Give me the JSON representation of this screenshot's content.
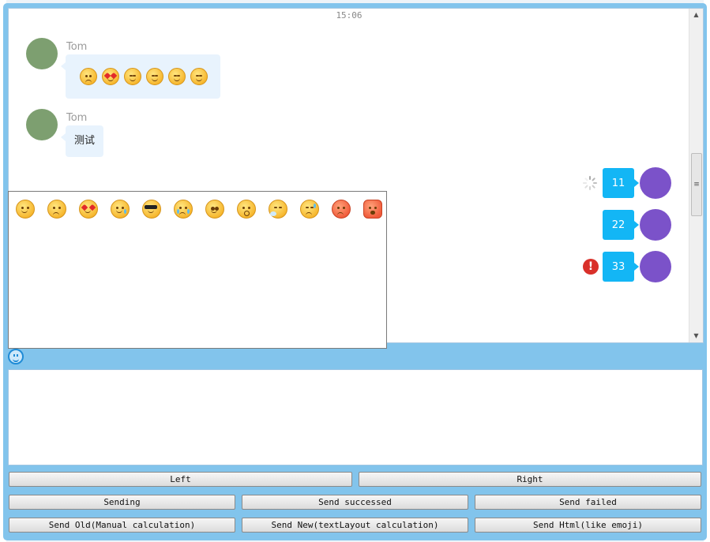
{
  "chat": {
    "timestamp": "15:06",
    "messages_left": [
      {
        "sender": "Tom",
        "type": "emoji",
        "emojis": [
          "worried-emoji",
          "heart-eyes-emoji",
          "smirk-emoji",
          "smirk-emoji",
          "smirk-emoji",
          "smirk-emoji"
        ]
      },
      {
        "sender": "Tom",
        "type": "text",
        "text": "测试"
      }
    ],
    "messages_right": [
      {
        "text": "11",
        "status": "sending"
      },
      {
        "text": "22",
        "status": "sent"
      },
      {
        "text": "33",
        "status": "failed"
      }
    ]
  },
  "emoji_panel": {
    "emojis": [
      "smile-emoji",
      "worried-emoji",
      "heart-eyes-emoji",
      "teary-emoji",
      "sunglasses-emoji",
      "crying-emoji",
      "dizzy-emoji",
      "surprised-emoji",
      "sleepy-emoji",
      "sweat-emoji",
      "angry-emoji",
      "furious-emoji"
    ]
  },
  "buttons": {
    "left": "Left",
    "right": "Right",
    "sending": "Sending",
    "send_successed": "Send successed",
    "send_failed": "Send failed",
    "send_old": "Send Old(Manual calculation)",
    "send_new": "Send New(textLayout calculation)",
    "send_html": "Send Html(like emoji)"
  },
  "colors": {
    "frame": "#82c4ec",
    "bubble_left": "#e8f3fd",
    "bubble_right": "#13b6f5",
    "avatar_left": "#7d9f70",
    "avatar_right": "#7b52c9",
    "error": "#d9302a"
  }
}
